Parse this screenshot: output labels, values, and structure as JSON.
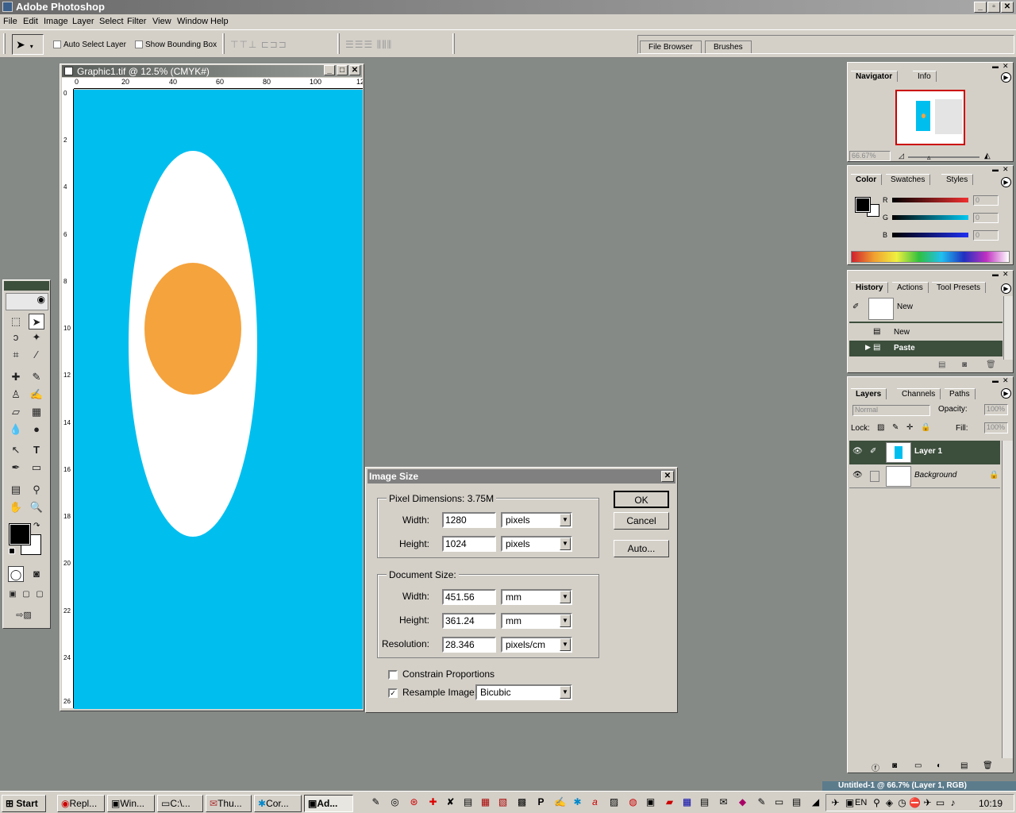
{
  "app": {
    "title": "Adobe Photoshop"
  },
  "menu": [
    "File",
    "Edit",
    "Image",
    "Layer",
    "Select",
    "Filter",
    "View",
    "Window",
    "Help"
  ],
  "options": {
    "auto_select": "Auto Select Layer",
    "bounding_box": "Show Bounding Box",
    "well_tabs": [
      "File Browser",
      "Brushes"
    ]
  },
  "document": {
    "title": "Graphic1.tif @ 12.5% (CMYK#)",
    "ruler_top": [
      "0",
      "20",
      "40",
      "60",
      "80",
      "100",
      "12"
    ],
    "ruler_left": [
      "0",
      "2",
      "4",
      "6",
      "8",
      "10",
      "12",
      "14",
      "16",
      "18",
      "20",
      "22",
      "24",
      "26"
    ],
    "colors": {
      "background": "#00bfef",
      "ellipse": "#ffffff",
      "circle": "#f5a33d"
    }
  },
  "navigator": {
    "tabs": [
      "Navigator",
      "Info"
    ],
    "zoom": "66.67%"
  },
  "color_panel": {
    "tabs": [
      "Color",
      "Swatches",
      "Styles"
    ],
    "channels": [
      "R",
      "G",
      "B"
    ],
    "values": [
      "0",
      "0",
      "0"
    ]
  },
  "history": {
    "tabs": [
      "History",
      "Actions",
      "Tool Presets"
    ],
    "snapshot": "New",
    "items": [
      "New",
      "Paste"
    ]
  },
  "layers": {
    "tabs": [
      "Layers",
      "Channels",
      "Paths"
    ],
    "blend_mode": "Normal",
    "opacity_label": "Opacity:",
    "opacity": "100%",
    "lock_label": "Lock:",
    "fill_label": "Fill:",
    "fill": "100%",
    "items": [
      "Layer 1",
      "Background"
    ]
  },
  "dialog": {
    "title": "Image Size",
    "pixel_dims_label": "Pixel Dimensions:",
    "pixel_dims_value": "3.75M",
    "width_label": "Width:",
    "height_label": "Height:",
    "px_width": "1280",
    "px_height": "1024",
    "px_unit": "pixels",
    "doc_size_label": "Document Size:",
    "doc_width": "451.56",
    "doc_height": "361.24",
    "doc_unit": "mm",
    "resolution_label": "Resolution:",
    "resolution": "28.346",
    "res_unit": "pixels/cm",
    "constrain": "Constrain Proportions",
    "resample": "Resample Image:",
    "resample_method": "Bicubic",
    "ok": "OK",
    "cancel": "Cancel",
    "auto": "Auto..."
  },
  "taskbar": {
    "start": "Start",
    "buttons": [
      "Repl...",
      "Win...",
      "C:\\...",
      "Thu...",
      "Cor...",
      "Ad..."
    ],
    "background_window": "Untitled-1 @ 66.7% (Layer 1, RGB)",
    "lang": "EN",
    "clock": "10:19"
  }
}
